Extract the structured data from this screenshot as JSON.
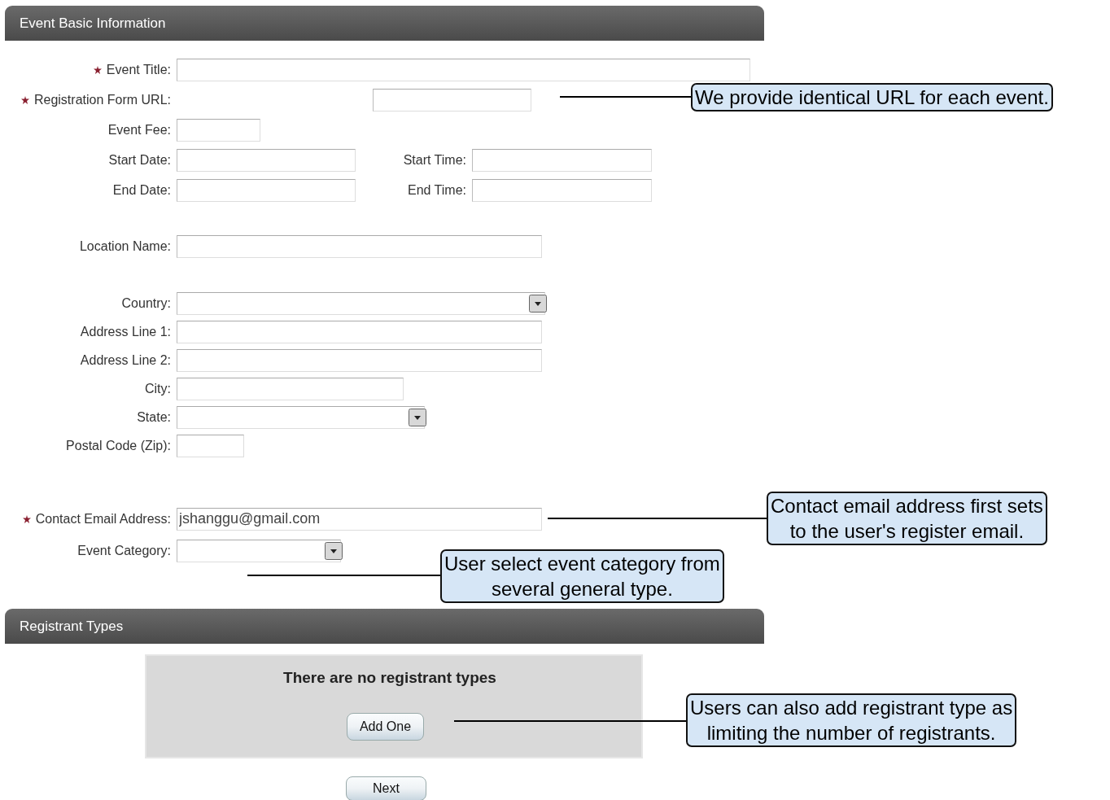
{
  "sections": [
    {
      "title": "Event Basic Information"
    },
    {
      "title": "Registrant Types"
    }
  ],
  "form_groups": [
    [
      {
        "fields": [
          {
            "label": "Event Title:",
            "kind": "text",
            "required": true
          }
        ]
      },
      {
        "fields": [
          {
            "label": "Registration Form URL:",
            "kind": "text",
            "required": true
          }
        ]
      },
      {
        "fields": [
          {
            "label": "Event Fee:",
            "kind": "text",
            "required": false
          }
        ]
      },
      {
        "fields": [
          {
            "label": "Start Date:",
            "kind": "text",
            "required": false
          },
          {
            "label": "Start Time:",
            "kind": "text",
            "required": false
          }
        ]
      },
      {
        "fields": [
          {
            "label": "End Date:",
            "kind": "text",
            "required": false
          },
          {
            "label": "End Time:",
            "kind": "text",
            "required": false
          }
        ]
      }
    ],
    [
      {
        "fields": [
          {
            "label": "Location Name:",
            "kind": "text",
            "required": false
          }
        ]
      }
    ],
    [
      {
        "fields": [
          {
            "label": "Country:",
            "kind": "select",
            "required": false
          }
        ]
      },
      {
        "fields": [
          {
            "label": "Address Line 1:",
            "kind": "text",
            "required": false
          }
        ]
      },
      {
        "fields": [
          {
            "label": "Address Line 2:",
            "kind": "text",
            "required": false
          }
        ]
      },
      {
        "fields": [
          {
            "label": "City:",
            "kind": "text",
            "required": false
          }
        ]
      },
      {
        "fields": [
          {
            "label": "State:",
            "kind": "select",
            "required": false
          }
        ]
      },
      {
        "fields": [
          {
            "label": "Postal Code (Zip):",
            "kind": "text",
            "required": false
          }
        ]
      }
    ],
    [
      {
        "fields": [
          {
            "label": "Contact Email Address:",
            "kind": "text",
            "required": true,
            "value": "jshanggu@gmail.com"
          }
        ]
      },
      {
        "fields": [
          {
            "label": "Event Category:",
            "kind": "select",
            "required": false
          }
        ]
      }
    ]
  ],
  "registrant_panel": {
    "message": "There are no registrant types",
    "button": "Add One"
  },
  "next_button": "Next",
  "annotations": [
    {
      "text": "We provide identical URL for each event."
    },
    {
      "text": "Contact email address first sets\nto the user's register email."
    },
    {
      "text": "User select event category from\nseveral general type."
    },
    {
      "text": "Users can also add registrant type as\nlimiting the number of registrants."
    }
  ]
}
